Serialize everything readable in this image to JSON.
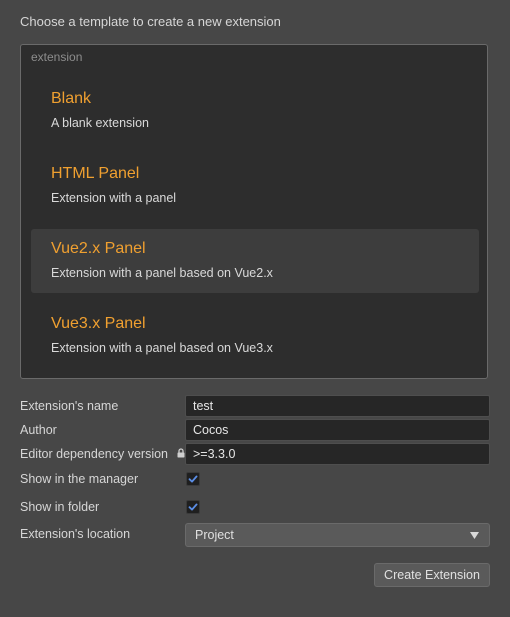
{
  "heading": "Choose a template to create a new extension",
  "template_group": {
    "label": "extension",
    "templates": [
      {
        "name": "Blank",
        "description": "A blank extension"
      },
      {
        "name": "HTML Panel",
        "description": "Extension with a panel"
      },
      {
        "name": "Vue2.x Panel",
        "description": "Extension with a panel based on Vue2.x",
        "selected": true
      },
      {
        "name": "Vue3.x Panel",
        "description": "Extension with a panel based on Vue3.x"
      }
    ]
  },
  "form": {
    "name_label": "Extension's name",
    "name_value": "test",
    "author_label": "Author",
    "author_value": "Cocos",
    "dependency_label": "Editor dependency version",
    "dependency_value": ">=3.3.0",
    "show_manager_label": "Show in the manager",
    "show_manager_checked": true,
    "show_folder_label": "Show in folder",
    "show_folder_checked": true,
    "location_label": "Extension's location",
    "location_value": "Project"
  },
  "create_button_label": "Create Extension",
  "colors": {
    "accent": "#f0a030",
    "checkbox_check": "#5b8ee6"
  }
}
